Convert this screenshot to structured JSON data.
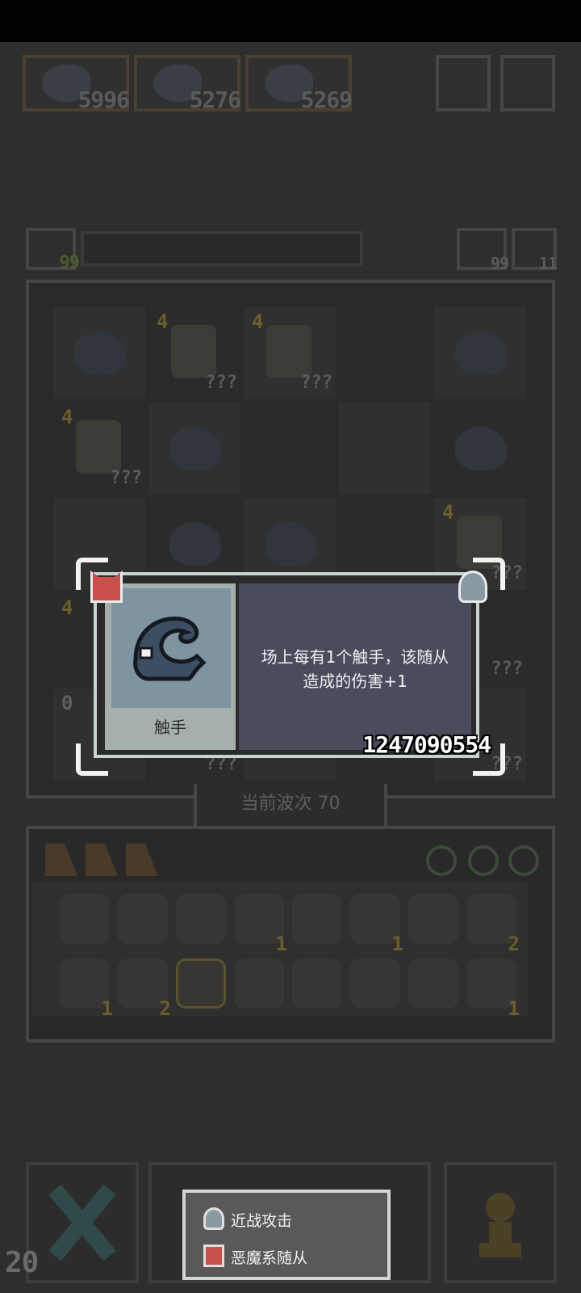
{
  "top_bar": {
    "boss_scores": [
      "5996",
      "5276",
      "5269"
    ]
  },
  "resources": {
    "gems": "99",
    "refresh_count": "99",
    "keys": "11"
  },
  "board": {
    "level_label": "4",
    "unknown_label": "???",
    "zero_label": "0"
  },
  "wave": {
    "label": "当前波次 70"
  },
  "inventory": {
    "counts": [
      "1",
      "1",
      "2",
      "1",
      "2",
      "1"
    ]
  },
  "tooltip": {
    "name": "触手",
    "description_line1": "场上每有1个触手，该随从",
    "description_line2": "造成的伤害+1",
    "damage_value": "1247090554"
  },
  "legend": {
    "melee_label": "近战攻击",
    "demon_label": "恶魔系随从"
  },
  "bottom": {
    "counter": "20"
  },
  "colors": {
    "demon_red": "#c9504a",
    "portrait_bg": "#7e94a0",
    "desc_bg": "#4a4c5e"
  }
}
